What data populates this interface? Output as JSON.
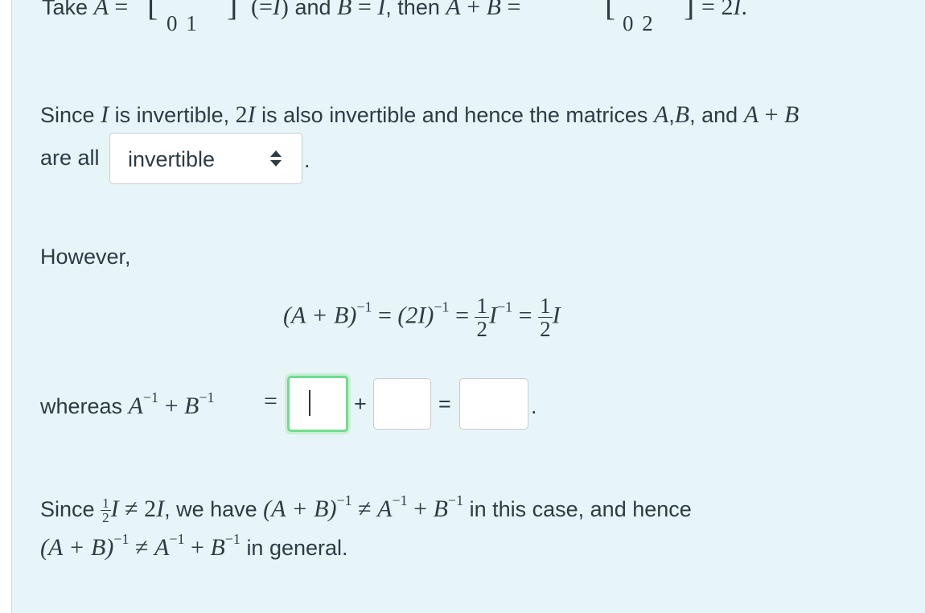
{
  "top_line": {
    "take": "Take",
    "A": "A",
    "eq1": "=",
    "matA_row": "0   1",
    "paren_eq": "(=",
    "I1": "I",
    "paren_close": ")",
    "and": "and",
    "B": "B",
    "eq2": "=",
    "I2": "I",
    "comma_then": ", then",
    "A2": "A",
    "plus": "+",
    "B2": "B",
    "eq3": "=",
    "matSum_row": "0   2",
    "eq4": "=",
    "result": "2",
    "resultI": "I",
    "period": "."
  },
  "para1": {
    "since": "Since",
    "I": "I",
    "is_invertible": "is invertible,",
    "two": "2",
    "I2": "I",
    "also": "is also invertible and hence the matrices",
    "A": "A",
    "comma": ",",
    "B": "B",
    "comma_and": ", and",
    "A2": "A",
    "plus": "+",
    "B2": "B",
    "are_all": "are all",
    "dot": "."
  },
  "dropdown": {
    "selected": "invertible"
  },
  "however": "However,",
  "display_eq": {
    "lhs": "(A + B)",
    "exp1": "−1",
    "eq1": "=",
    "mid": "(2I)",
    "exp2": "−1",
    "eq2": "=",
    "frac1_num": "1",
    "frac1_den": "2",
    "I1": "I",
    "exp3": "−1",
    "eq3": "=",
    "frac2_num": "1",
    "frac2_den": "2",
    "I2": "I"
  },
  "whereas": {
    "label": "whereas",
    "A": "A",
    "expA": "−1",
    "plus": "+",
    "B": "B",
    "expB": "−1",
    "eq": "=",
    "op_plus": "+",
    "op_eq": "=",
    "dot": "."
  },
  "conclusion": {
    "since": "Since",
    "frac_num": "1",
    "frac_den": "2",
    "I": "I",
    "neq": "≠",
    "two": "2",
    "I2": "I",
    "we_have": ", we have",
    "lhs": "(A + B)",
    "exp1": "−1",
    "neq2": "≠",
    "A": "A",
    "expA": "−1",
    "plus": "+",
    "B": "B",
    "expB": "−1",
    "tail": "in this case, and hence",
    "line2_lhs": "(A + B)",
    "line2_exp": "−1",
    "line2_neq": "≠",
    "line2_A": "A",
    "line2_expA": "−1",
    "line2_plus": "+",
    "line2_B": "B",
    "line2_expB": "−1",
    "line2_tail": "in general."
  }
}
